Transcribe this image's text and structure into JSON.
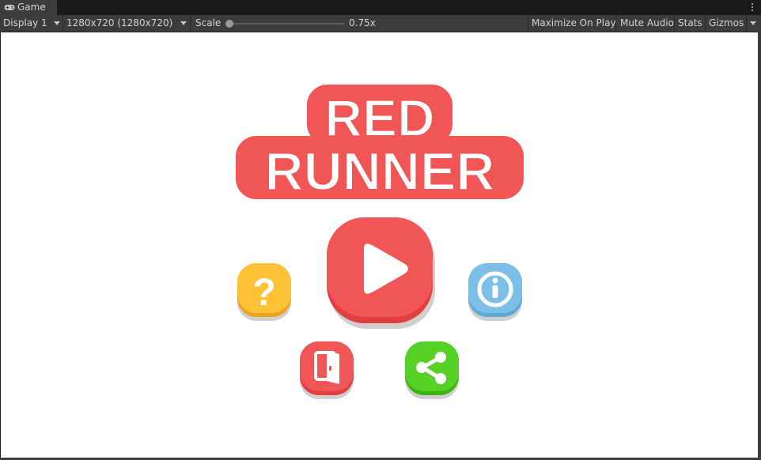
{
  "tab": {
    "title": "Game",
    "icon": "gamepad-icon"
  },
  "toolbar": {
    "display": "Display 1",
    "resolution": "1280x720 (1280x720)",
    "scale_label": "Scale",
    "scale_value": "0.75x",
    "scale_fraction": 0.0,
    "maximize": "Maximize On Play",
    "mute": "Mute Audio",
    "stats": "Stats",
    "gizmos": "Gizmos"
  },
  "game": {
    "logo_line1": "RED",
    "logo_line2": "RUNNER",
    "colors": {
      "red": "#f05656",
      "red_dark": "#e23e3e",
      "yellow": "#fec236",
      "blue": "#7bbfe6",
      "green": "#56d126",
      "shadow": "#c7c7c7"
    },
    "buttons": [
      "play-icon",
      "question-icon",
      "info-icon",
      "exit-door-icon",
      "share-icon"
    ]
  }
}
